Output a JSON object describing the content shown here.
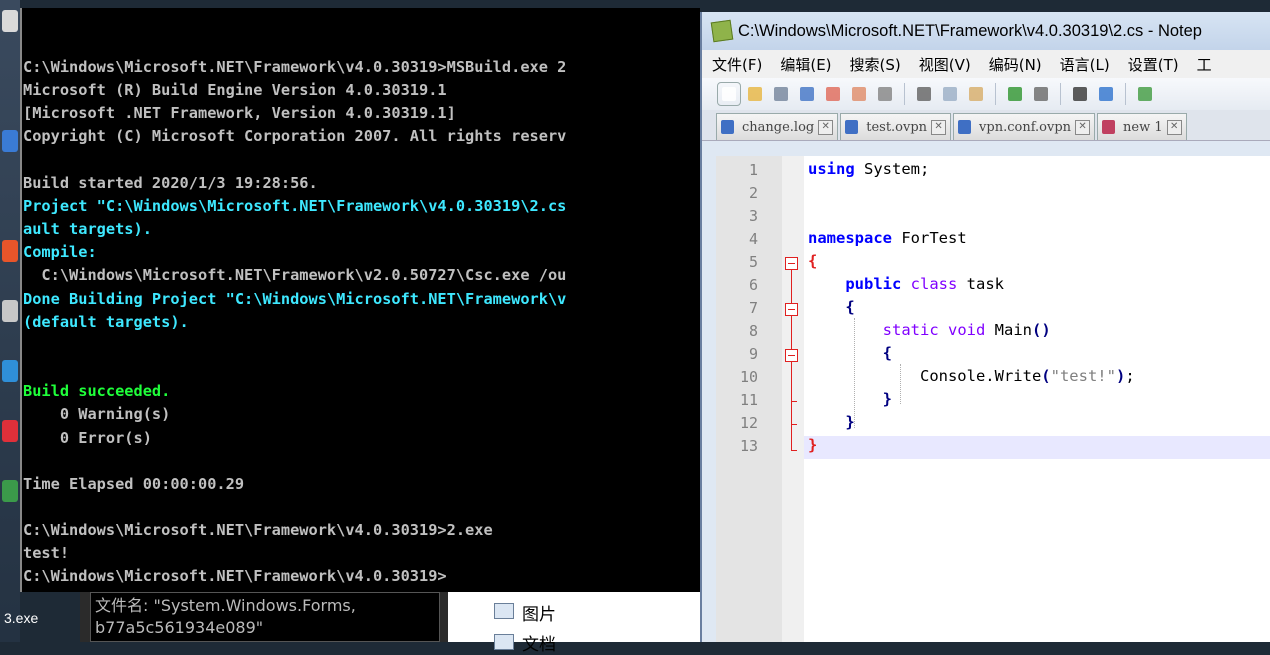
{
  "desktop": {
    "bottom_left_label": "3.exe",
    "file_box_lines": [
      "文件名: \"System.Windows.Forms,",
      "b77a5c561934e089\""
    ],
    "explorer_items": [
      "图片",
      "文档"
    ]
  },
  "console": {
    "lines": [
      {
        "text": "C:\\Windows\\Microsoft.NET\\Framework\\v4.0.30319>MSBuild.exe 2",
        "color": "default"
      },
      {
        "text": "Microsoft (R) Build Engine Version 4.0.30319.1",
        "color": "default"
      },
      {
        "text": "[Microsoft .NET Framework, Version 4.0.30319.1]",
        "color": "default"
      },
      {
        "text": "Copyright (C) Microsoft Corporation 2007. All rights reserv",
        "color": "default"
      },
      {
        "text": "",
        "color": "default"
      },
      {
        "text": "Build started 2020/1/3 19:28:56.",
        "color": "default"
      },
      {
        "text": "Project \"C:\\Windows\\Microsoft.NET\\Framework\\v4.0.30319\\2.cs",
        "color": "cyan"
      },
      {
        "text": "ault targets).",
        "color": "cyan"
      },
      {
        "text": "Compile:",
        "color": "cyan"
      },
      {
        "text": "  C:\\Windows\\Microsoft.NET\\Framework\\v2.0.50727\\Csc.exe /ou",
        "color": "default"
      },
      {
        "text": "Done Building Project \"C:\\Windows\\Microsoft.NET\\Framework\\v",
        "color": "cyan"
      },
      {
        "text": "(default targets).",
        "color": "cyan"
      },
      {
        "text": "",
        "color": "default"
      },
      {
        "text": "",
        "color": "default"
      },
      {
        "text": "Build succeeded.",
        "color": "green"
      },
      {
        "text": "    0 Warning(s)",
        "color": "default"
      },
      {
        "text": "    0 Error(s)",
        "color": "default"
      },
      {
        "text": "",
        "color": "default"
      },
      {
        "text": "Time Elapsed 00:00:00.29",
        "color": "default"
      },
      {
        "text": "",
        "color": "default"
      },
      {
        "text": "C:\\Windows\\Microsoft.NET\\Framework\\v4.0.30319>2.exe",
        "color": "default"
      },
      {
        "text": "test!",
        "color": "default"
      },
      {
        "text": "C:\\Windows\\Microsoft.NET\\Framework\\v4.0.30319>",
        "color": "default"
      }
    ]
  },
  "notepad": {
    "title": "C:\\Windows\\Microsoft.NET\\Framework\\v4.0.30319\\2.cs - Notep",
    "menu": [
      "文件(F)",
      "编辑(E)",
      "搜索(S)",
      "视图(V)",
      "编码(N)",
      "语言(L)",
      "设置(T)",
      "工"
    ],
    "toolbar_icons": [
      "new-file-icon",
      "open-file-icon",
      "save-icon",
      "save-all-icon",
      "close-icon",
      "close-all-icon",
      "print-icon",
      "cut-icon",
      "copy-icon",
      "paste-icon",
      "undo-icon",
      "redo-icon",
      "find-icon",
      "replace-icon",
      "zoom-in-icon"
    ],
    "tabs": [
      {
        "label": "change.log",
        "modified": false
      },
      {
        "label": "test.ovpn",
        "modified": false
      },
      {
        "label": "vpn.conf.ovpn",
        "modified": false
      },
      {
        "label": "new 1",
        "modified": true
      }
    ],
    "line_numbers": [
      "1",
      "2",
      "3",
      "4",
      "5",
      "6",
      "7",
      "8",
      "9",
      "10",
      "11",
      "12",
      "13"
    ],
    "current_line": 13
  }
}
